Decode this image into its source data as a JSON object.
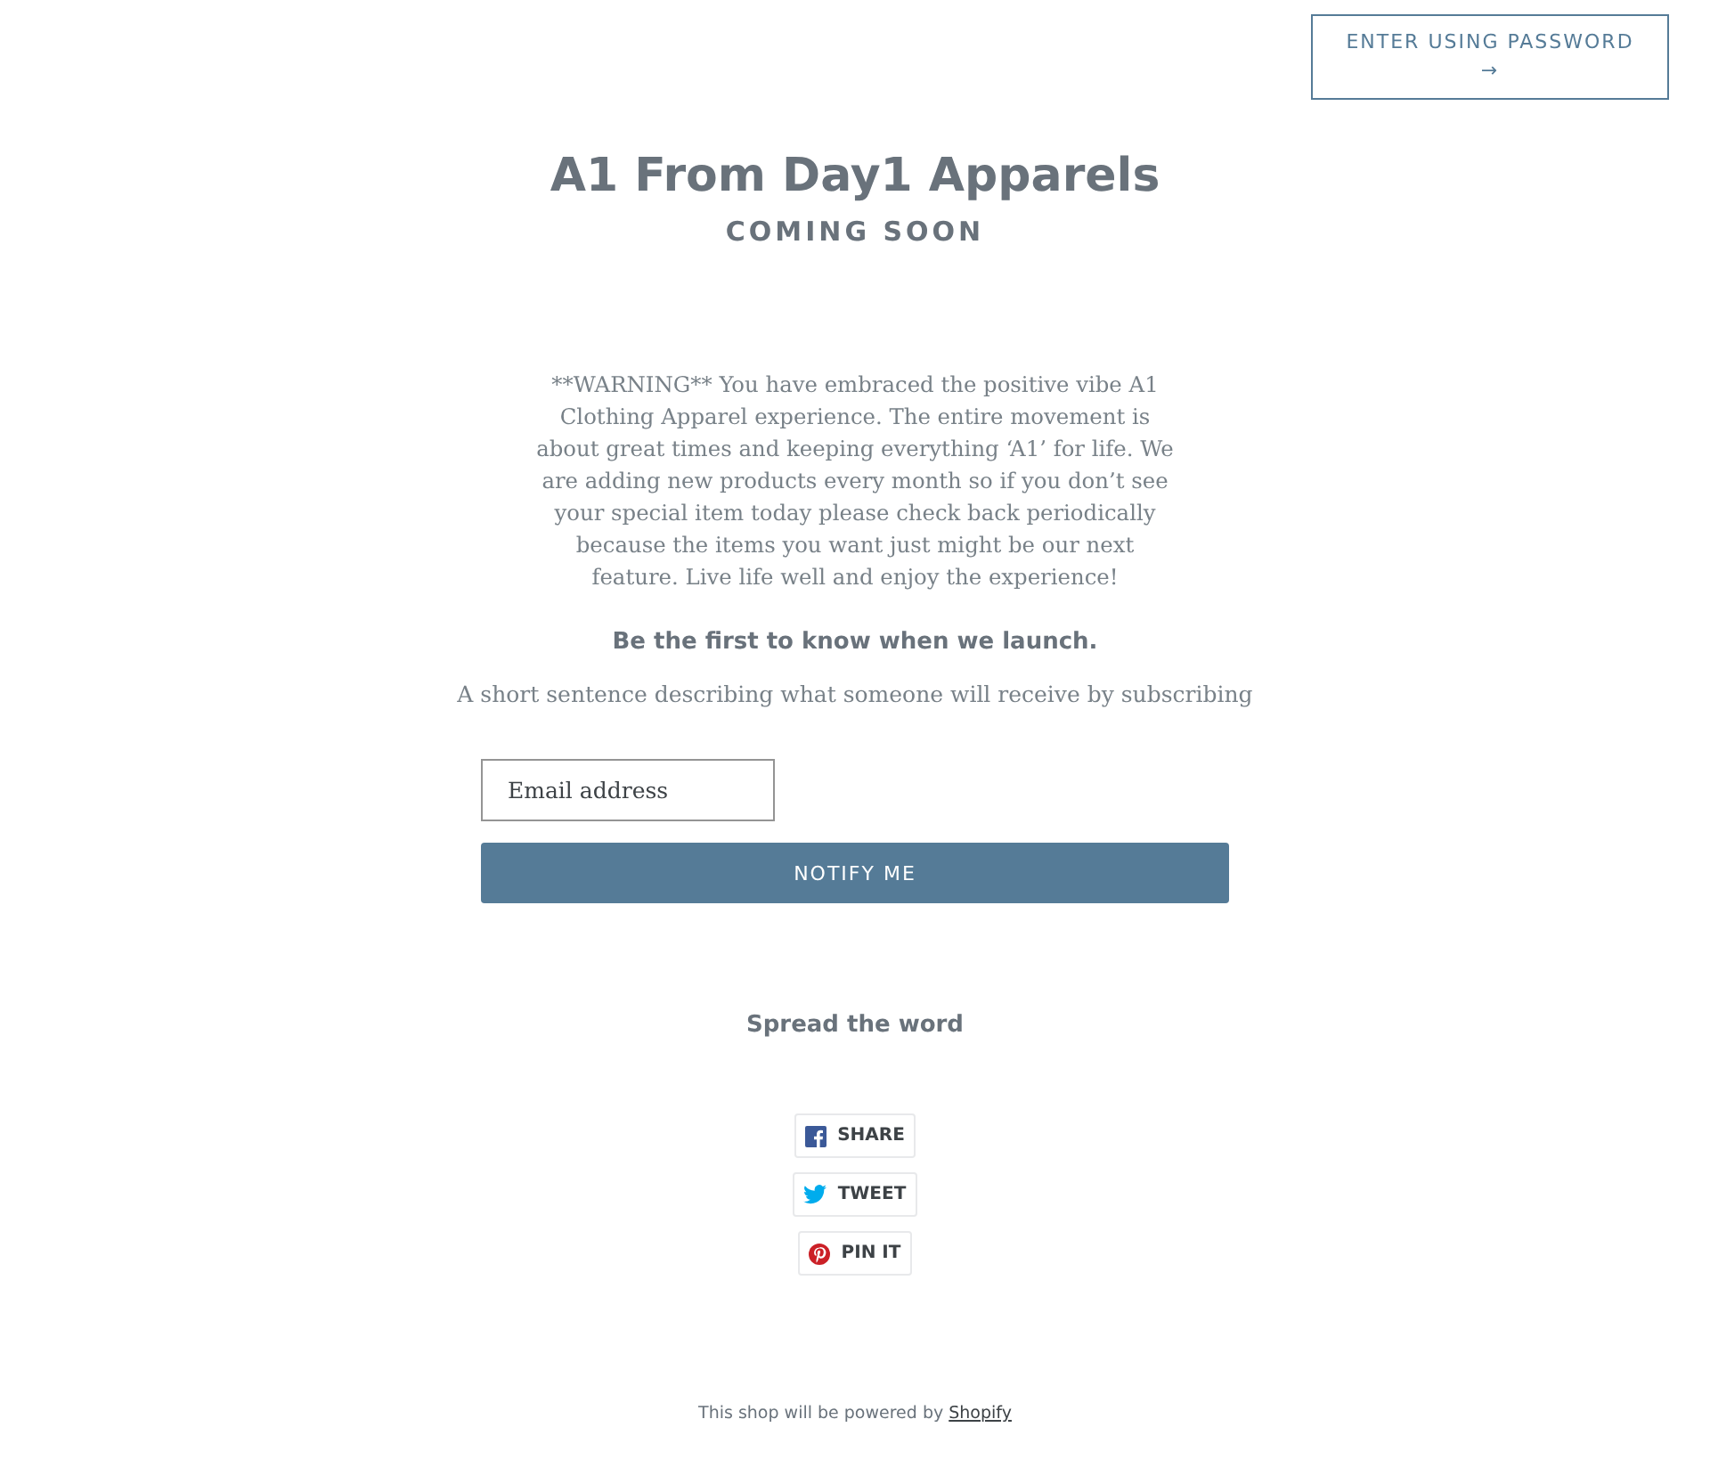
{
  "header": {
    "password_button": {
      "label": "ENTER USING PASSWORD",
      "arrow": "→"
    }
  },
  "hero": {
    "title": "A1 From Day1 Apparels",
    "subtitle": "COMING SOON"
  },
  "message": "**WARNING** You have embraced the positive vibe A1 Clothing Apparel experience. The entire movement is about great times and keeping everything ‘A1’ for life. We are adding new products every month so if you don’t see your special item today please check back periodically because the items you want just might be our next feature. Live life well and enjoy the experience!",
  "signup": {
    "heading": "Be the first to know when we launch.",
    "description": "A short sentence describing what someone will receive by subscribing",
    "email": {
      "placeholder": "Email address"
    },
    "button": "NOTIFY ME"
  },
  "share": {
    "heading": "Spread the word",
    "buttons": [
      {
        "kind": "facebook",
        "label": "SHARE"
      },
      {
        "kind": "twitter",
        "label": "TWEET"
      },
      {
        "kind": "pinterest",
        "label": "PIN IT"
      }
    ]
  },
  "footer": {
    "text": "This shop will be powered by",
    "link": "Shopify"
  }
}
